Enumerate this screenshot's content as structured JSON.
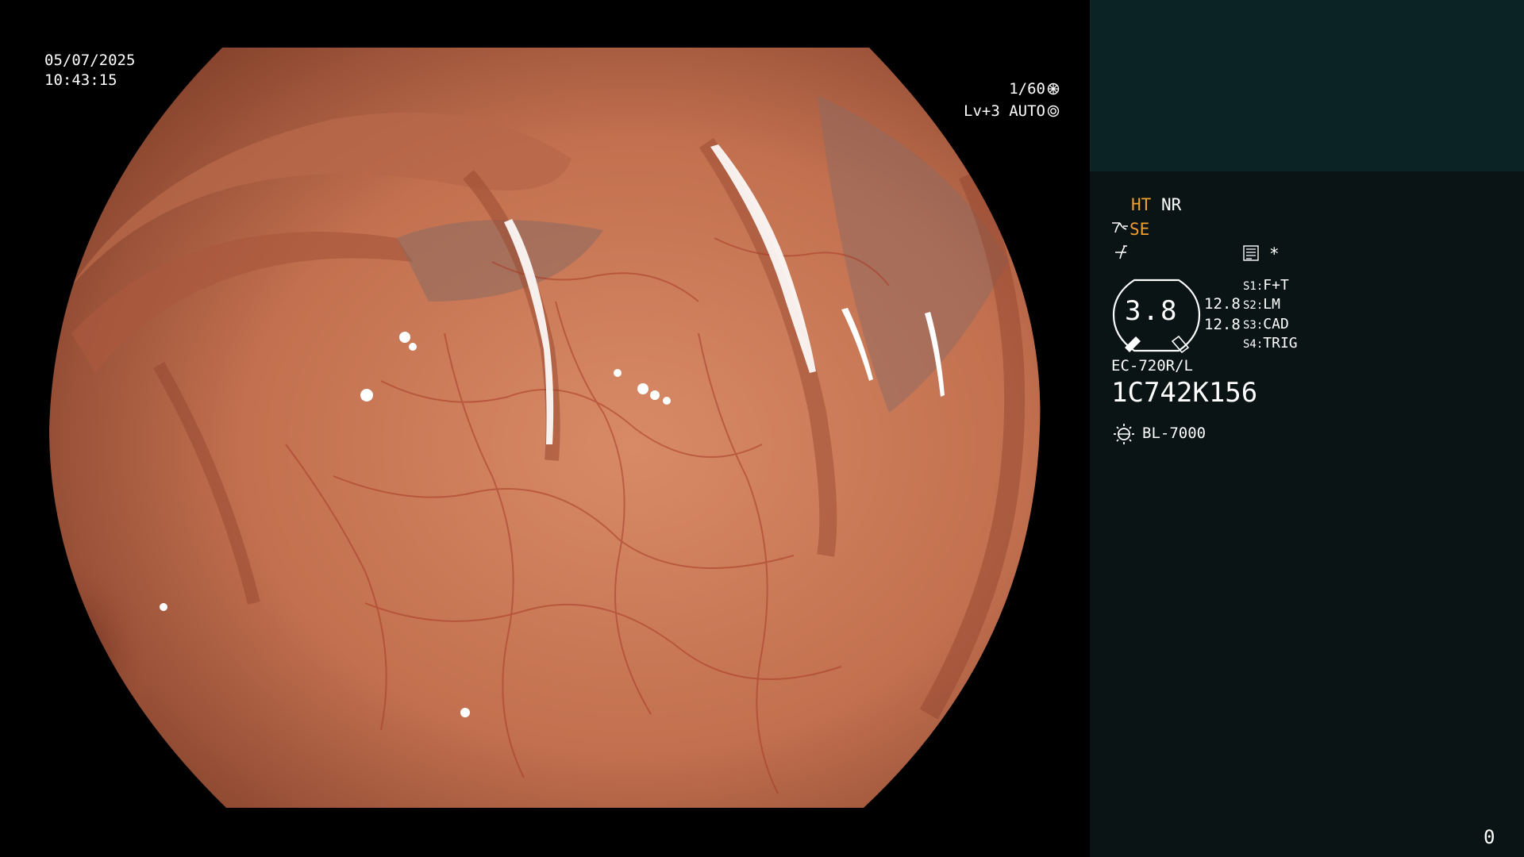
{
  "overlay": {
    "date": "05/07/2025",
    "time": "10:43:15",
    "shutter": "1/60",
    "light_level": "Lv+3 AUTO"
  },
  "info": {
    "ht": "HT",
    "nr": "NR",
    "se": "SE",
    "asterisk": "*",
    "gauge_value": "3.8",
    "value_1": "12.8",
    "value_2": "12.8",
    "switches": [
      {
        "key": "S1",
        "label": "F+T"
      },
      {
        "key": "S2",
        "label": "LM"
      },
      {
        "key": "S3",
        "label": "CAD"
      },
      {
        "key": "S4",
        "label": "TRIG"
      }
    ],
    "scope_model": "EC-720R/L",
    "serial": "1C742K156",
    "light_source": "BL-7000",
    "counter": "0"
  },
  "colors": {
    "panel_bg": "#0a1414",
    "patient_box_bg": "#0b2325",
    "accent_orange": "#f0a030",
    "tissue": "#c8775a"
  },
  "icons": [
    "shutter-icon",
    "auto-iris-icon",
    "enhance-icon",
    "freeze-icon",
    "structure-icon",
    "gauge-icon",
    "lamp-icon"
  ]
}
